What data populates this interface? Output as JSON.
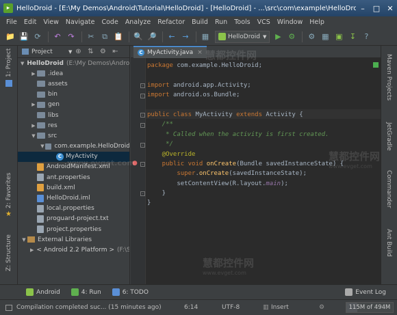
{
  "window": {
    "title": "HelloDroid - [E:\\My Demos\\Android\\Tutorial\\HelloDroid] - [HelloDroid] - ...\\src\\com\\example\\HelloDroid\\MyActivity.java"
  },
  "menu": [
    "File",
    "Edit",
    "View",
    "Navigate",
    "Code",
    "Analyze",
    "Refactor",
    "Build",
    "Run",
    "Tools",
    "VCS",
    "Window",
    "Help"
  ],
  "toolbar": {
    "run_config": "HelloDroid"
  },
  "left_tabs": {
    "project": "1: Project",
    "favorites": "2: Favorites",
    "structure": "Z: Structure"
  },
  "right_tabs": {
    "maven": "Maven Projects",
    "gradle": "JetGradle",
    "commander": "Commander",
    "ant": "Ant Build"
  },
  "project_panel": {
    "view": "Project",
    "tree": [
      {
        "label": "HelloDroid",
        "extra": "(E:\\My Demos\\Android",
        "level": 0,
        "type": "folder",
        "expanded": true
      },
      {
        "label": ".idea",
        "level": 1,
        "type": "folder",
        "expanded": false
      },
      {
        "label": "assets",
        "level": 1,
        "type": "folder"
      },
      {
        "label": "bin",
        "level": 1,
        "type": "folder"
      },
      {
        "label": "gen",
        "level": 1,
        "type": "folder",
        "expanded": false
      },
      {
        "label": "libs",
        "level": 1,
        "type": "folder"
      },
      {
        "label": "res",
        "level": 1,
        "type": "folder",
        "expanded": false
      },
      {
        "label": "src",
        "level": 1,
        "type": "folder",
        "expanded": true
      },
      {
        "label": "com.example.HelloDroid",
        "level": 2,
        "type": "package",
        "expanded": true
      },
      {
        "label": "MyActivity",
        "level": 3,
        "type": "class",
        "selected": true
      },
      {
        "label": "AndroidManifest.xml",
        "level": 1,
        "type": "xml"
      },
      {
        "label": "ant.properties",
        "level": 1,
        "type": "prop"
      },
      {
        "label": "build.xml",
        "level": 1,
        "type": "xml"
      },
      {
        "label": "HelloDroid.iml",
        "level": 1,
        "type": "iml"
      },
      {
        "label": "local.properties",
        "level": 1,
        "type": "prop"
      },
      {
        "label": "proguard-project.txt",
        "level": 1,
        "type": "prop"
      },
      {
        "label": "project.properties",
        "level": 1,
        "type": "prop"
      },
      {
        "label": "External Libraries",
        "level": 0,
        "type": "lib",
        "expanded": true
      },
      {
        "label": "< Android 2.2 Platform >",
        "extra": "(F:\\S",
        "level": 1,
        "type": "lib",
        "expanded": false
      }
    ]
  },
  "editor": {
    "tab": "MyActivity.java",
    "lines": [
      [
        [
          "kw",
          "package "
        ],
        [
          "tx",
          "com.example.HelloDroid;"
        ]
      ],
      [],
      [
        [
          "kw",
          "import "
        ],
        [
          "tx",
          "android.app.Activity;"
        ]
      ],
      [
        [
          "kw",
          "import "
        ],
        [
          "tx",
          "android.os.Bundle;"
        ]
      ],
      [],
      [
        [
          "kw",
          "public class "
        ],
        [
          "tx",
          "MyActivity "
        ],
        [
          "kw",
          "extends "
        ],
        [
          "tx",
          "Activity {"
        ]
      ],
      [
        [
          "cm",
          "    /**"
        ]
      ],
      [
        [
          "cm",
          "     * Called when the activity is first created."
        ]
      ],
      [
        [
          "cm",
          "     */"
        ]
      ],
      [
        [
          "an",
          "    @Override"
        ]
      ],
      [
        [
          "kw",
          "    public void "
        ],
        [
          "fn",
          "onCreate"
        ],
        [
          "tx",
          "(Bundle savedInstanceState) {"
        ]
      ],
      [
        [
          "kw",
          "        super"
        ],
        [
          "tx",
          "."
        ],
        [
          "fn",
          "onCreate"
        ],
        [
          "tx",
          "(savedInstanceState);"
        ]
      ],
      [
        [
          "tx",
          "        setContentView(R.layout."
        ],
        [
          "fld",
          "main"
        ],
        [
          "tx",
          ");"
        ]
      ],
      [
        [
          "tx",
          "    }"
        ]
      ],
      [
        [
          "tx",
          "}"
        ]
      ]
    ]
  },
  "bottom_tabs": [
    {
      "label": "Android",
      "icon": "android-icon"
    },
    {
      "label": "4: Run",
      "icon": "run-icon"
    },
    {
      "label": "6: TODO",
      "icon": "todo-icon"
    },
    {
      "label": "Event Log",
      "icon": "event-log-icon"
    }
  ],
  "status": {
    "message": "Compilation completed suc... (15 minutes ago)",
    "position": "6:14",
    "encoding": "UTF-8",
    "insert_mode": "Insert",
    "memory": "115M of 494M",
    "memory_used_fraction": 0.233
  },
  "watermark": {
    "cn": "慧都控件网",
    "url": "www.evget.com"
  }
}
